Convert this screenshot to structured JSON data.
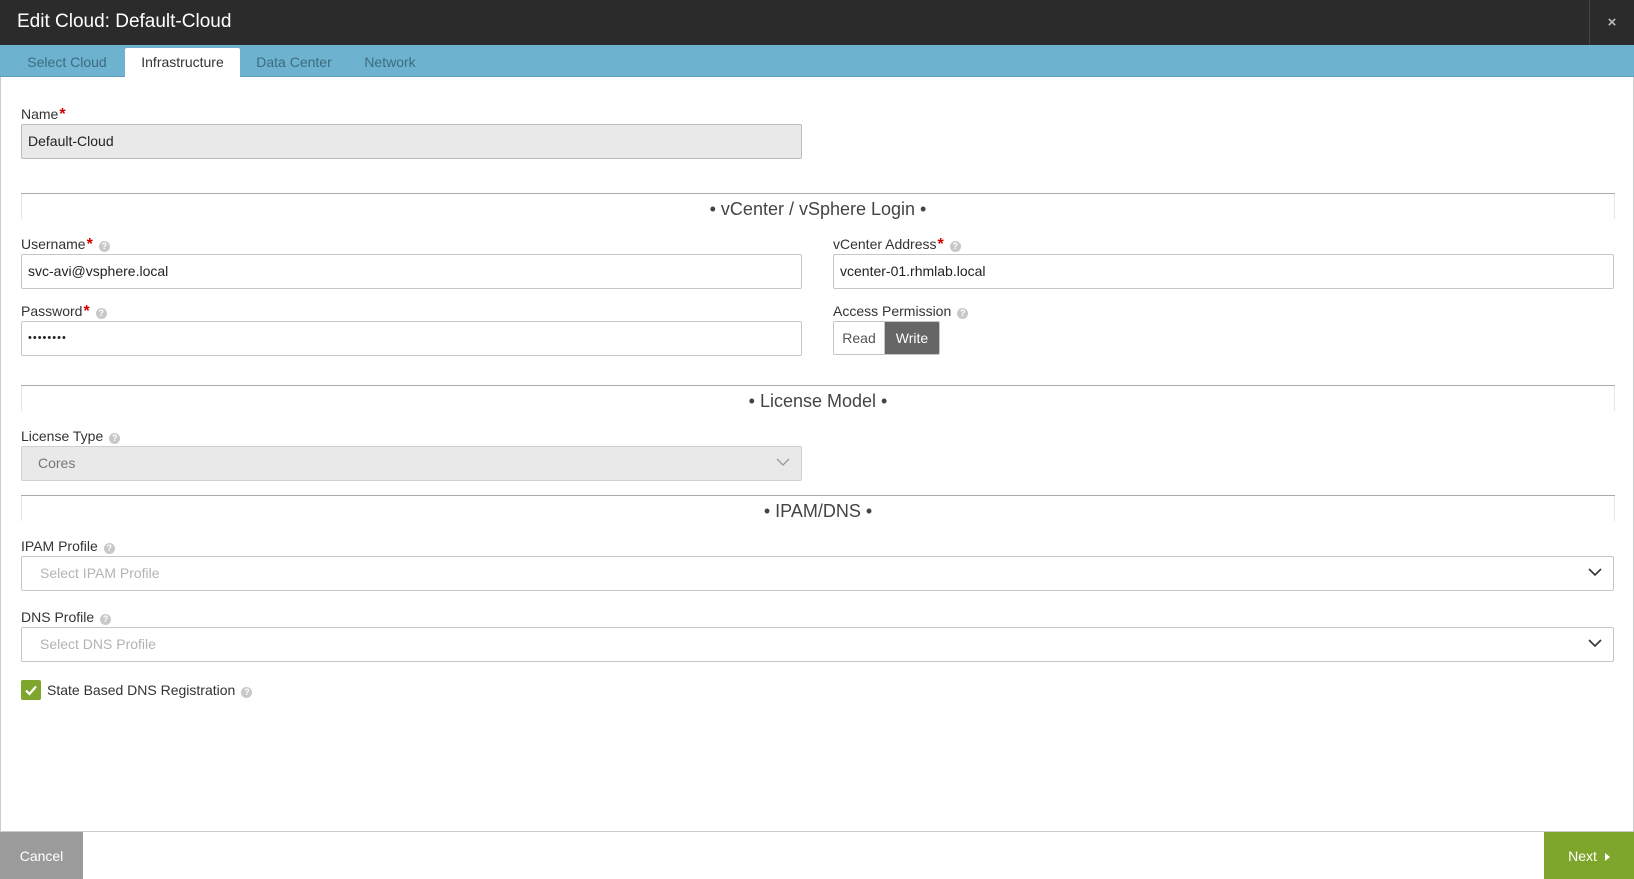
{
  "window": {
    "title": "Edit Cloud: Default-Cloud",
    "close_glyph": "×"
  },
  "tabs": [
    {
      "label": "Select Cloud",
      "active": false
    },
    {
      "label": "Infrastructure",
      "active": true
    },
    {
      "label": "Data Center",
      "active": false
    },
    {
      "label": "Network",
      "active": false
    }
  ],
  "name": {
    "label": "Name",
    "value": "Default-Cloud"
  },
  "vcenter_section": {
    "title": "• vCenter / vSphere Login •",
    "username": {
      "label": "Username",
      "value": "svc-avi@vsphere.local"
    },
    "password": {
      "label": "Password",
      "value": "••••••••"
    },
    "vcenter_address": {
      "label": "vCenter Address",
      "value": "vcenter-01.rhmlab.local"
    },
    "access_permission": {
      "label": "Access Permission",
      "options": [
        "Read",
        "Write"
      ],
      "selected": "Write"
    }
  },
  "license_section": {
    "title": "• License Model •",
    "license_type": {
      "label": "License Type",
      "value": "Cores"
    }
  },
  "ipam_section": {
    "title": "• IPAM/DNS •",
    "ipam_profile": {
      "label": "IPAM Profile",
      "placeholder": "Select IPAM Profile"
    },
    "dns_profile": {
      "label": "DNS Profile",
      "placeholder": "Select DNS Profile"
    },
    "state_based_dns": {
      "label": "State Based DNS Registration",
      "checked": true
    }
  },
  "footer": {
    "cancel_label": "Cancel",
    "next_label": "Next"
  },
  "colors": {
    "titlebar": "#2b2b2b",
    "tabbar": "#6db3d0",
    "accent_green": "#7ea52c",
    "required": "#d40000"
  },
  "icons": {
    "close": "close-icon",
    "help": "help-icon",
    "dropdown": "chevron-down-icon",
    "check": "check-icon",
    "next_arrow": "caret-right-icon"
  }
}
